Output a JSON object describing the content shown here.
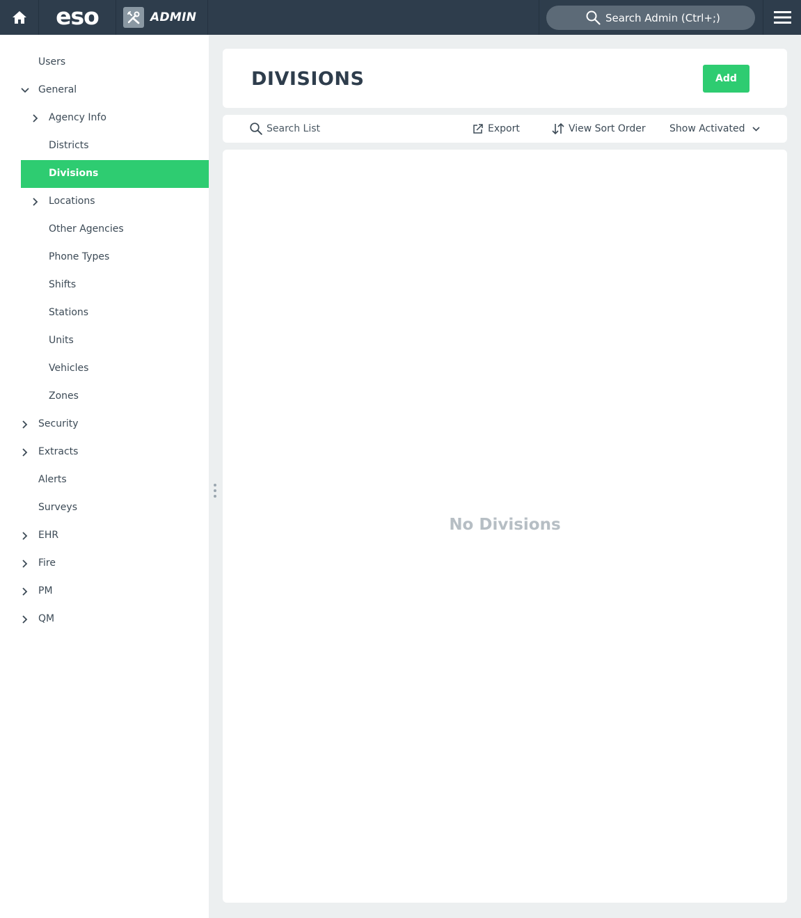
{
  "topbar": {
    "home_icon": "home-icon",
    "logo_text": "eso",
    "admin_label": "ADMIN",
    "admin_icon": "tools-icon",
    "search_placeholder": "Search Admin (Ctrl+;)",
    "menu_icon": "hamburger-icon"
  },
  "sidebar": {
    "items": [
      {
        "label": "Users"
      },
      {
        "label": "General",
        "expanded": true
      },
      {
        "label": "Agency Info"
      },
      {
        "label": "Districts"
      },
      {
        "label": "Divisions",
        "active": true
      },
      {
        "label": "Locations"
      },
      {
        "label": "Other Agencies"
      },
      {
        "label": "Phone Types"
      },
      {
        "label": "Shifts"
      },
      {
        "label": "Stations"
      },
      {
        "label": "Units"
      },
      {
        "label": "Vehicles"
      },
      {
        "label": "Zones"
      },
      {
        "label": "Security"
      },
      {
        "label": "Extracts"
      },
      {
        "label": "Alerts"
      },
      {
        "label": "Surveys"
      },
      {
        "label": "EHR"
      },
      {
        "label": "Fire"
      },
      {
        "label": "PM"
      },
      {
        "label": "QM"
      }
    ]
  },
  "main": {
    "title": "DIVISIONS",
    "add_label": "Add",
    "toolbar": {
      "search_label": "Search List",
      "export_label": "Export",
      "sort_label": "View Sort Order",
      "filter_label": "Show Activated"
    },
    "empty_message": "No Divisions"
  },
  "colors": {
    "topbar_bg": "#2e3d4c",
    "accent_green": "#2ecc71",
    "page_bg": "#eceff0",
    "text": "#3c4a56"
  }
}
